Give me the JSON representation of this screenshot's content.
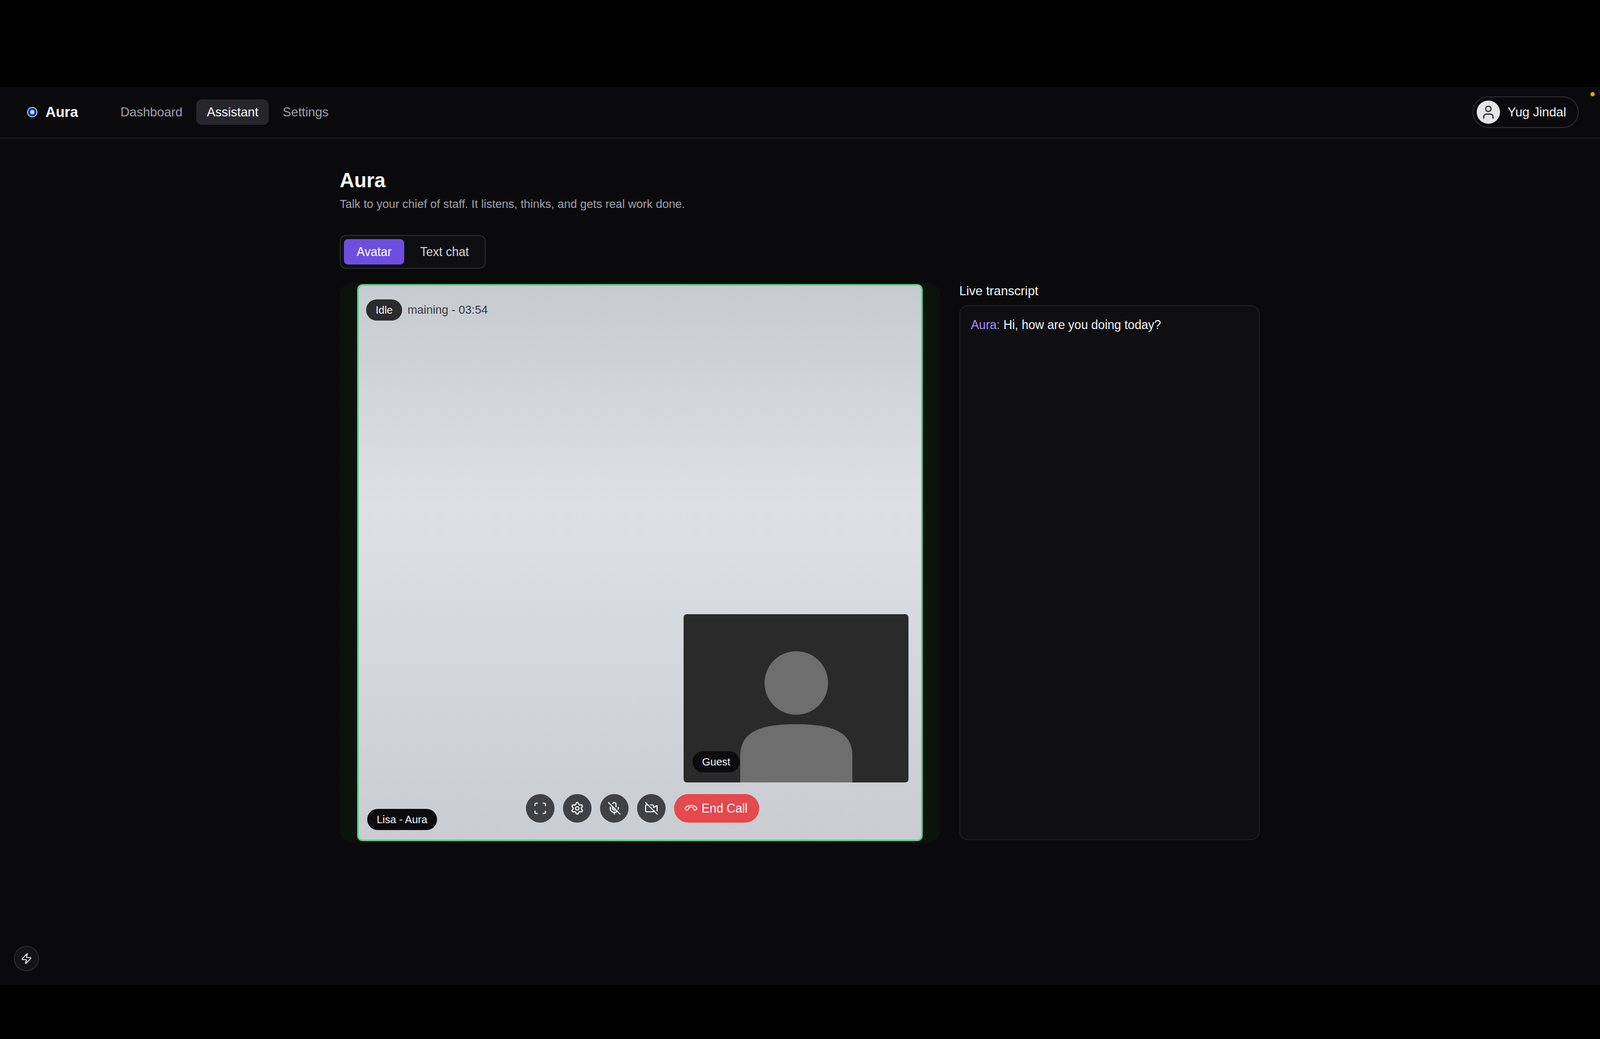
{
  "app": {
    "name": "Aura",
    "notification": true
  },
  "nav": [
    {
      "label": "Dashboard",
      "selected": false
    },
    {
      "label": "Assistant",
      "selected": true
    },
    {
      "label": "Settings",
      "selected": false
    }
  ],
  "user": {
    "name": "Yug Jindal"
  },
  "page": {
    "title": "Aura",
    "subtitle": "Talk to your chief of staff. It listens, thinks, and gets real work done."
  },
  "modes": [
    {
      "label": "Avatar",
      "selected": true
    },
    {
      "label": "Text chat",
      "selected": false
    }
  ],
  "call": {
    "status": "Idle",
    "timer": "maining - 03:54",
    "agent_label": "Lisa - Aura",
    "guest_label": "Guest",
    "microphone_muted": true,
    "camera_off": true,
    "end_button": "End Call"
  },
  "transcript": {
    "title": "Live transcript",
    "entries": [
      {
        "speaker": "Aura",
        "text": "Hi, how are you doing today?"
      }
    ]
  }
}
